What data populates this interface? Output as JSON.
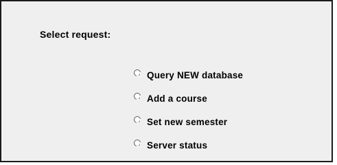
{
  "form": {
    "heading": "Select request:",
    "options": [
      {
        "label": "Query NEW database",
        "selected": false
      },
      {
        "label": "Add a course",
        "selected": false
      },
      {
        "label": "Set new semester",
        "selected": false
      },
      {
        "label": "Server status",
        "selected": false
      }
    ]
  },
  "colors": {
    "panel_background": "#efefef",
    "border": "#1a1a1a",
    "text": "#000000"
  }
}
